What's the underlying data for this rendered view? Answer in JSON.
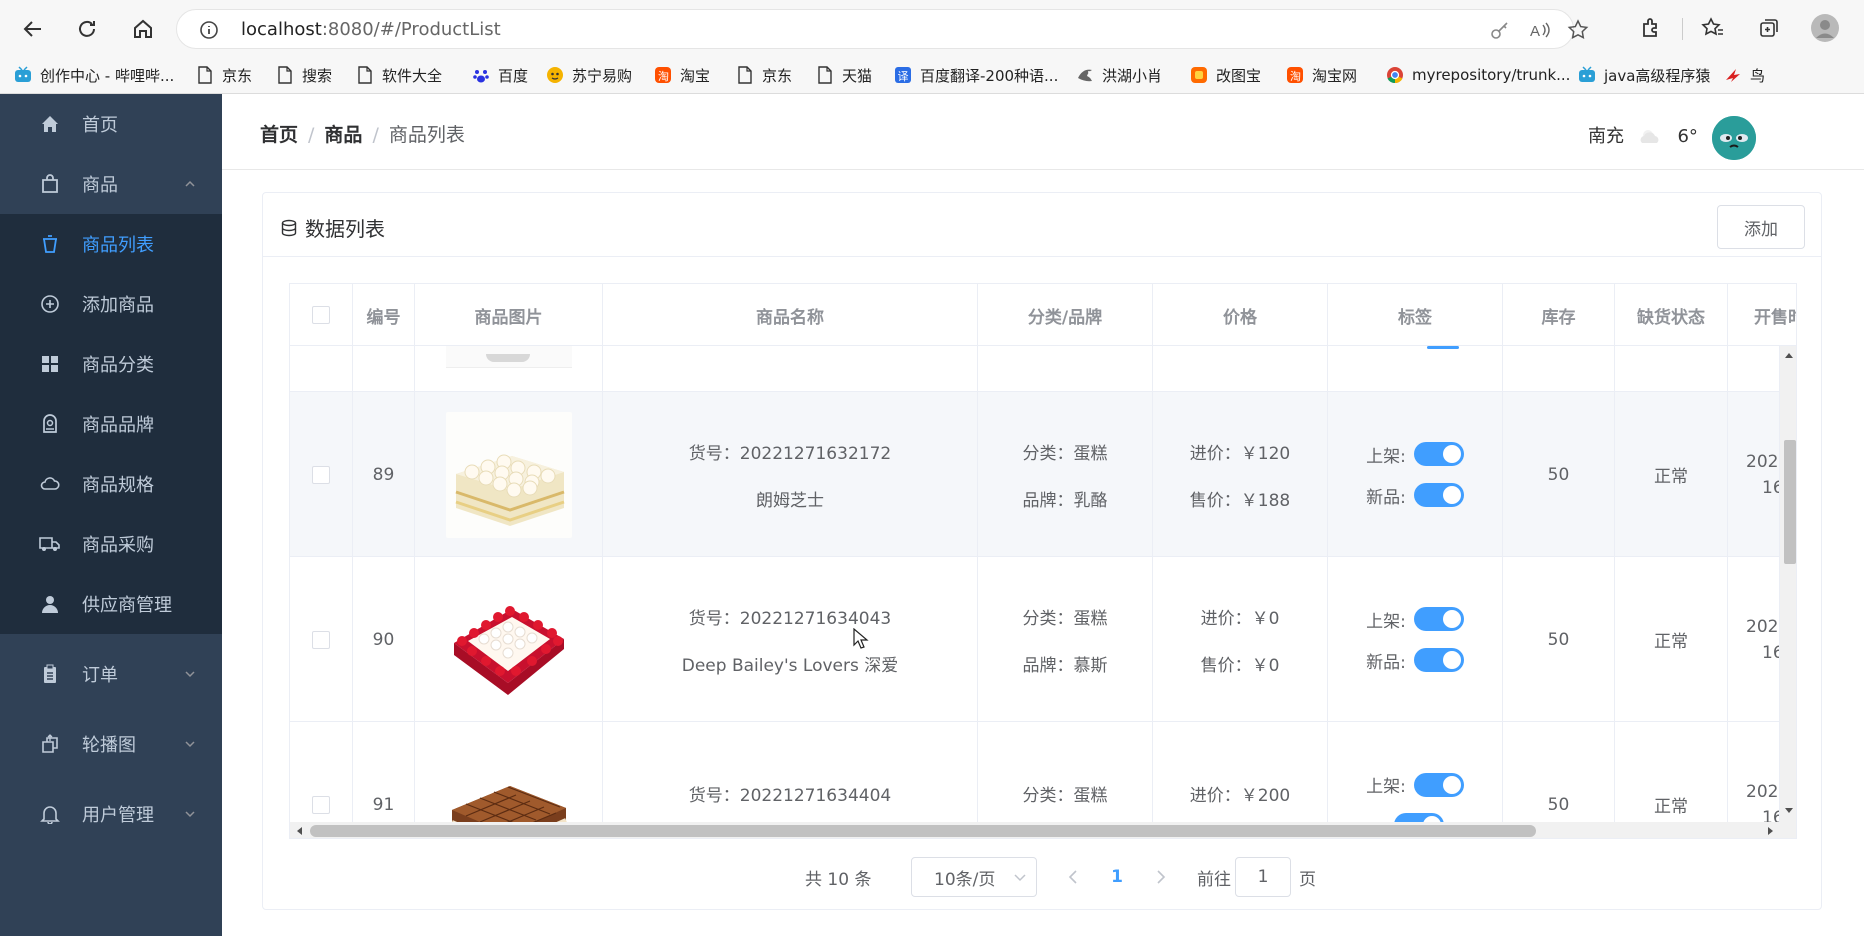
{
  "browser": {
    "url_host": "localhost",
    "url_rest": ":8080/#/ProductList",
    "bookmarks": [
      {
        "label": "创作中心 - 哔哩哔...",
        "icon": "bilibili-icon"
      },
      {
        "label": "京东",
        "icon": "page-icon"
      },
      {
        "label": "搜索",
        "icon": "page-icon"
      },
      {
        "label": "软件大全",
        "icon": "page-icon"
      },
      {
        "label": "百度",
        "icon": "baidu-paw-icon"
      },
      {
        "label": "苏宁易购",
        "icon": "suning-icon"
      },
      {
        "label": "淘宝",
        "icon": "taobao-icon"
      },
      {
        "label": "京东",
        "icon": "page-icon"
      },
      {
        "label": "天猫",
        "icon": "page-icon"
      },
      {
        "label": "百度翻译-200种语...",
        "icon": "translate-icon"
      },
      {
        "label": "洪湖小肖",
        "icon": "bird-icon"
      },
      {
        "label": "改图宝",
        "icon": "gaitubao-icon"
      },
      {
        "label": "淘宝网",
        "icon": "taobao-icon"
      },
      {
        "label": "myrepository/trunk...",
        "icon": "chrome-icon"
      },
      {
        "label": "java高级程序猿",
        "icon": "bilibili-icon"
      },
      {
        "label": "鸟",
        "icon": "bird-red-icon"
      }
    ]
  },
  "sidebar": {
    "items": [
      {
        "label": "首页",
        "icon": "home-icon"
      },
      {
        "label": "商品",
        "icon": "bag-icon"
      },
      {
        "label": "商品列表",
        "icon": "cup-icon"
      },
      {
        "label": "添加商品",
        "icon": "plus-circle-icon"
      },
      {
        "label": "商品分类",
        "icon": "grid-icon"
      },
      {
        "label": "商品品牌",
        "icon": "brand-icon"
      },
      {
        "label": "商品规格",
        "icon": "cloud-icon"
      },
      {
        "label": "商品采购",
        "icon": "truck-icon"
      },
      {
        "label": "供应商管理",
        "icon": "user-icon"
      },
      {
        "label": "订单",
        "icon": "clipboard-icon"
      },
      {
        "label": "轮播图",
        "icon": "carousel-icon"
      },
      {
        "label": "用户管理",
        "icon": "bell-icon"
      }
    ]
  },
  "header": {
    "breadcrumb": [
      "首页",
      "商品",
      "商品列表"
    ],
    "breadcrumb_sep": "/",
    "city": "南充",
    "temp": "6°"
  },
  "card": {
    "title": "数据列表",
    "add_label": "添加"
  },
  "table": {
    "columns": [
      "编号",
      "商品图片",
      "商品名称",
      "分类/品牌",
      "价格",
      "标签",
      "库存",
      "缺货状态",
      "开售时"
    ],
    "rows": [
      {
        "id": "89",
        "sku": "货号：20221271632172",
        "name": "朗姆芝士",
        "category": "分类：蛋糕",
        "brand": "品牌：乳酪",
        "buy_price": "进价：￥120",
        "sell_price": "售价：￥188",
        "tag_on_shelf": "上架:",
        "tag_new": "新品:",
        "stock": "50",
        "status": "正常",
        "sale_1": "202",
        "sale_2": "16"
      },
      {
        "id": "90",
        "sku": "货号：20221271634043",
        "name": "Deep Bailey's Lovers 深爱",
        "category": "分类：蛋糕",
        "brand": "品牌：慕斯",
        "buy_price": "进价：￥0",
        "sell_price": "售价：￥0",
        "tag_on_shelf": "上架:",
        "tag_new": "新品:",
        "stock": "50",
        "status": "正常",
        "sale_1": "202",
        "sale_2": "16"
      },
      {
        "id": "91",
        "sku": "货号：20221271634404",
        "name": "",
        "category": "分类：蛋糕",
        "brand": "",
        "buy_price": "进价：￥200",
        "sell_price": "",
        "tag_on_shelf": "上架:",
        "tag_new": "",
        "stock": "50",
        "status": "正常",
        "sale_1": "202",
        "sale_2": "16"
      }
    ],
    "switch_on": true
  },
  "pager": {
    "total": "共 10 条",
    "page_size": "10条/页",
    "current": "1",
    "goto_prefix": "前往",
    "goto_value": "1",
    "goto_suffix": "页"
  },
  "colors": {
    "sidebar_bg": "#304156",
    "submenu_bg": "#1f2d3d",
    "accent": "#409eff"
  }
}
